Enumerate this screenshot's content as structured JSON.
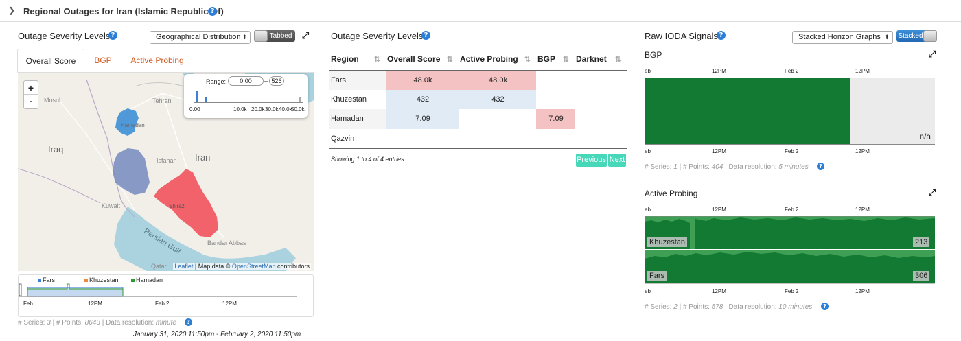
{
  "header": {
    "title": "Regional Outages for Iran (Islamic Republic Of)"
  },
  "left": {
    "title": "Outage Severity Levels",
    "view_select": "Geographical Distribution",
    "view_toggle": "Tabbed",
    "tabs": [
      "Overall Score",
      "BGP",
      "Active Probing"
    ],
    "zoom_in": "+",
    "zoom_out": "-",
    "range_label": "Range:",
    "range_min": "0.00",
    "range_sep": "–",
    "range_max": "526",
    "hist_ticks": [
      "0.00",
      "10.0k",
      "20.0k",
      "30.0k",
      "40.0k",
      "50.0k"
    ],
    "map_labels": {
      "mosul": "Mosul",
      "tehran": "Tehran",
      "hamadan": "Hamadan",
      "iraq": "Iraq",
      "iran": "Iran",
      "isfahan": "Isfahan",
      "kuwait": "Kuwait",
      "shiraz": "Shiraz",
      "persian_gulf": "Persian Gulf",
      "bandar_abbas": "Bandar Abbas",
      "qatar": "Qatar"
    },
    "region_colors": {
      "hamadan": "#3d8fd6",
      "khuzestan": "#7b8fc0",
      "fars": "#f05a63"
    },
    "attribution": {
      "leaflet": "Leaflet",
      "mid": " | Map data © ",
      "osm": "OpenStreetMap",
      "end": " contributors"
    },
    "mini_legend": [
      {
        "name": "Fars",
        "color": "#3d7fd6"
      },
      {
        "name": "Khuzestan",
        "color": "#f08a3a"
      },
      {
        "name": "Hamadan",
        "color": "#2f9a2f"
      }
    ],
    "mini_axis": [
      "Feb",
      "12PM",
      "Feb 2",
      "12PM"
    ],
    "meta": {
      "series_label": "# Series:",
      "series": "3",
      "points_label": "# Points:",
      "points": "8643",
      "res_label": "Data resolution:",
      "res": "minute"
    },
    "time_range": "January 31, 2020 11:50pm - February 2, 2020 11:50pm"
  },
  "middle": {
    "title": "Outage Severity Levels",
    "columns": [
      "Region",
      "Overall Score",
      "Active Probing",
      "BGP",
      "Darknet"
    ],
    "rows": [
      {
        "region": "Fars",
        "overall": "48.0k",
        "probing": "48.0k",
        "bgp": "",
        "darknet": ""
      },
      {
        "region": "Khuzestan",
        "overall": "432",
        "probing": "432",
        "bgp": "",
        "darknet": ""
      },
      {
        "region": "Hamadan",
        "overall": "7.09",
        "probing": "",
        "bgp": "7.09",
        "darknet": ""
      },
      {
        "region": "Qazvin",
        "overall": "",
        "probing": "",
        "bgp": "",
        "darknet": ""
      }
    ],
    "cell_colors": {
      "red": "#f4c2c2",
      "blue": "#e1ebf6"
    },
    "showing": "Showing 1 to 4 of 4 entries",
    "prev": "Previous",
    "next": "Next"
  },
  "right": {
    "title": "Raw IODA Signals",
    "view_select": "Stacked Horizon Graphs",
    "view_toggle": "Stacked",
    "bgp": {
      "title": "BGP",
      "axis": [
        "eb",
        "12PM",
        "Feb 2",
        "12PM"
      ],
      "na": "n/a",
      "meta": {
        "series_label": "# Series:",
        "series": "1",
        "points_label": "# Points:",
        "points": "404",
        "res_label": "Data resolution:",
        "res": "5 minutes"
      }
    },
    "probing": {
      "title": "Active Probing",
      "axis": [
        "eb",
        "12PM",
        "Feb 2",
        "12PM"
      ],
      "rows": [
        {
          "name": "Khuzestan",
          "value": "213"
        },
        {
          "name": "Fars",
          "value": "306"
        }
      ],
      "meta": {
        "series_label": "# Series:",
        "series": "2",
        "points_label": "# Points:",
        "points": "578",
        "res_label": "Data resolution:",
        "res": "10 minutes"
      }
    },
    "colors": {
      "dark_green": "#137a34",
      "light_green": "#3fa055",
      "gray": "#ebebeb"
    }
  }
}
